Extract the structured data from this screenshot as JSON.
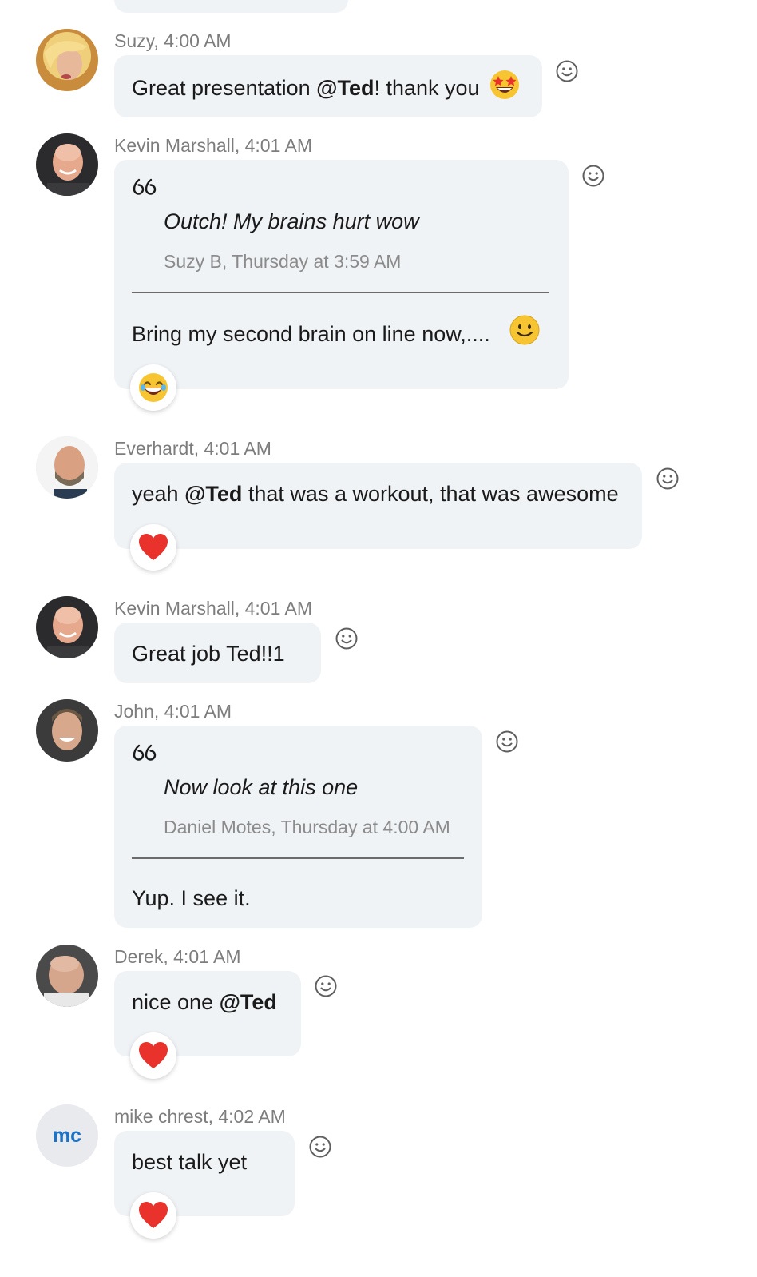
{
  "messages": [
    {
      "author_time": "Suzy, 4:00 AM",
      "text_before": "Great presentation ",
      "mention": "@Ted",
      "text_after": "! thank you"
    },
    {
      "author_time": "Kevin Marshall, 4:01 AM",
      "quote_text": "Outch! My brains hurt wow",
      "quote_source": "Suzy B, Thursday at 3:59 AM",
      "text": "Bring my second brain on line now,....",
      "reaction": "laughing-emoji"
    },
    {
      "author_time": "Everhardt, 4:01 AM",
      "text_before": "yeah ",
      "mention": "@Ted",
      "text_after": " that was a workout, that was awesome",
      "reaction": "heart-emoji"
    },
    {
      "author_time": "Kevin Marshall, 4:01 AM",
      "text": "Great job Ted!!1"
    },
    {
      "author_time": "John, 4:01 AM",
      "quote_text": "Now look at this one",
      "quote_source": "Daniel Motes, Thursday at 4:00 AM",
      "text": "Yup. I see it."
    },
    {
      "author_time": "Derek, 4:01 AM",
      "text_before": "nice one ",
      "mention": "@Ted",
      "reaction": "heart-emoji"
    },
    {
      "author_time": "mike chrest, 4:02 AM",
      "avatar_initials": "mc",
      "text": "best talk yet",
      "reaction": "heart-emoji"
    }
  ],
  "colors": {
    "bubble": "#f0f3f6",
    "meta": "#7d7d7d",
    "initials": "#1a73c8",
    "heart": "#e8322b"
  }
}
